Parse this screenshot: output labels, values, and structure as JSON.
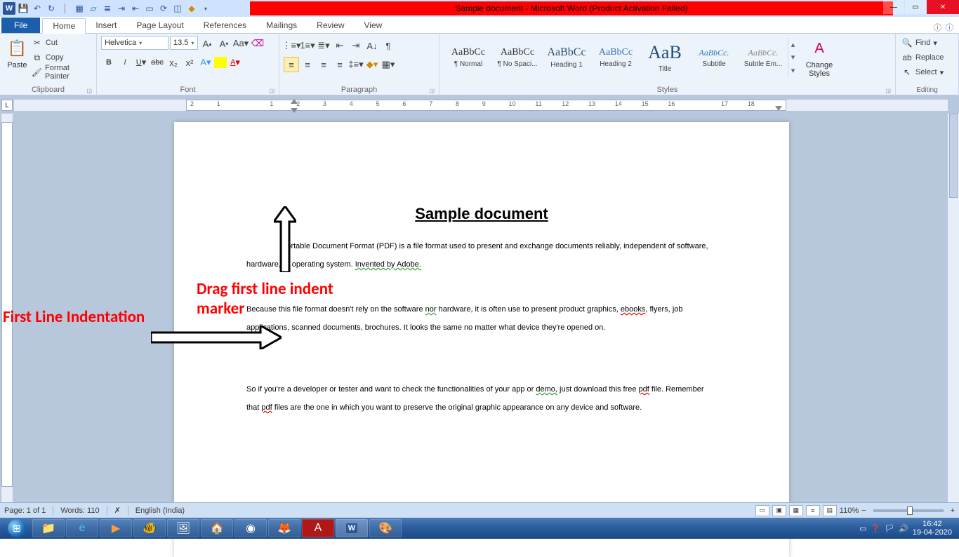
{
  "titlebar": {
    "title": "Sample document  -  Microsoft Word (Product Activation Failed)"
  },
  "tabs": {
    "file": "File",
    "list": [
      "Home",
      "Insert",
      "Page Layout",
      "References",
      "Mailings",
      "Review",
      "View"
    ],
    "active": "Home"
  },
  "clipboard": {
    "paste": "Paste",
    "cut": "Cut",
    "copy": "Copy",
    "fmt": "Format Painter",
    "label": "Clipboard"
  },
  "font": {
    "name": "Helvetica",
    "size": "13.5",
    "label": "Font"
  },
  "paragraph": {
    "label": "Paragraph"
  },
  "styles": {
    "label": "Styles",
    "items": [
      {
        "prev": "AaBbCc",
        "name": "¶ Normal"
      },
      {
        "prev": "AaBbCc",
        "name": "¶ No Spaci..."
      },
      {
        "prev": "AaBbCc",
        "name": "Heading 1",
        "col": "#1f4e79",
        "sz": "16px"
      },
      {
        "prev": "AaBbCc",
        "name": "Heading 2",
        "col": "#2e74b5",
        "sz": "14px"
      },
      {
        "prev": "AaB",
        "name": "Title",
        "col": "#1f4e79",
        "sz": "26px"
      },
      {
        "prev": "AaBbCc.",
        "name": "Subtitle",
        "col": "#2e74b5",
        "sz": "12px",
        "it": true
      },
      {
        "prev": "AaBbCc.",
        "name": "Subtle Em...",
        "col": "#888",
        "sz": "12px",
        "it": true
      }
    ],
    "change": "Change\nStyles"
  },
  "editing": {
    "find": "Find",
    "replace": "Replace",
    "select": "Select",
    "label": "Editing"
  },
  "ruler": {
    "ticks": [
      "2",
      "1",
      "",
      "1",
      "2",
      "3",
      "4",
      "5",
      "6",
      "7",
      "8",
      "9",
      "10",
      "11",
      "12",
      "13",
      "14",
      "15",
      "16",
      "",
      "17",
      "18"
    ]
  },
  "doc": {
    "title": "Sample document",
    "p1a": "Portable Document Format (PDF) is a file format used to present and exchange documents reliably, independent of software, hardware, or operating system. ",
    "p1b": "Invented by Adobe.",
    "p2a": "Because this file format doesn't rely on the software ",
    "p2nor": "nor",
    "p2b": " hardware, it is often use to present product graphics, ",
    "p2ebooks": "ebooks",
    "p2c": ", flyers, job applications, scanned documents, brochures. It looks the same no matter what device they're opened on.",
    "p3a": "So if you're a developer or tester and want to check the functionalities of your app or ",
    "p3demo": "demo,",
    "p3b": " just download this free ",
    "p3pdf1": "pdf",
    "p3c": " file. Remember that ",
    "p3pdf2": "pdf",
    "p3d": " files are the one in which you want to preserve the original graphic appearance on any device and software."
  },
  "anno": {
    "left": "First Line Indentation",
    "right": "Drag first line indent\nmarker"
  },
  "status": {
    "page": "Page: 1 of 1",
    "words": "Words: 110",
    "lang": "English (India)",
    "zoom": "110%"
  },
  "tray": {
    "time": "16:42",
    "date": "19-04-2020"
  }
}
